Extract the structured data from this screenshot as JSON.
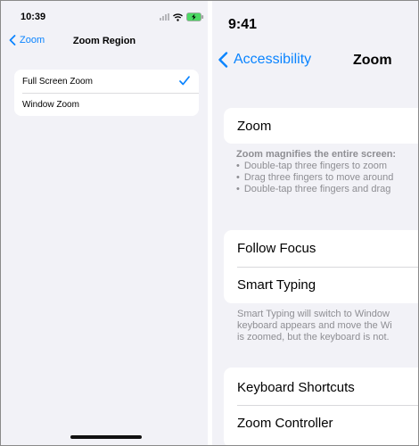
{
  "left_screen": {
    "status_time": "10:39",
    "back_label": "Zoom",
    "title": "Zoom Region",
    "options": [
      {
        "label": "Full Screen Zoom",
        "selected": true
      },
      {
        "label": "Window Zoom",
        "selected": false
      }
    ]
  },
  "right_screen": {
    "status_time": "9:41",
    "back_label": "Accessibility",
    "title": "Zoom",
    "zoom_row": "Zoom",
    "zoom_desc_heading": "Zoom magnifies the entire screen:",
    "zoom_desc_bullets": [
      "Double-tap three fingers to zoom",
      "Drag three fingers to move around",
      "Double-tap three fingers and drag"
    ],
    "follow_focus": "Follow Focus",
    "smart_typing": "Smart Typing",
    "smart_typing_desc": [
      "Smart Typing will switch to Window",
      "keyboard appears and move the Wi",
      "is zoomed, but the keyboard is not."
    ],
    "keyboard_shortcuts": "Keyboard Shortcuts",
    "zoom_controller": "Zoom Controller"
  },
  "colors": {
    "accent": "#0a84ff",
    "background": "#f2f2f7",
    "secondary_text": "#8e8e93"
  }
}
